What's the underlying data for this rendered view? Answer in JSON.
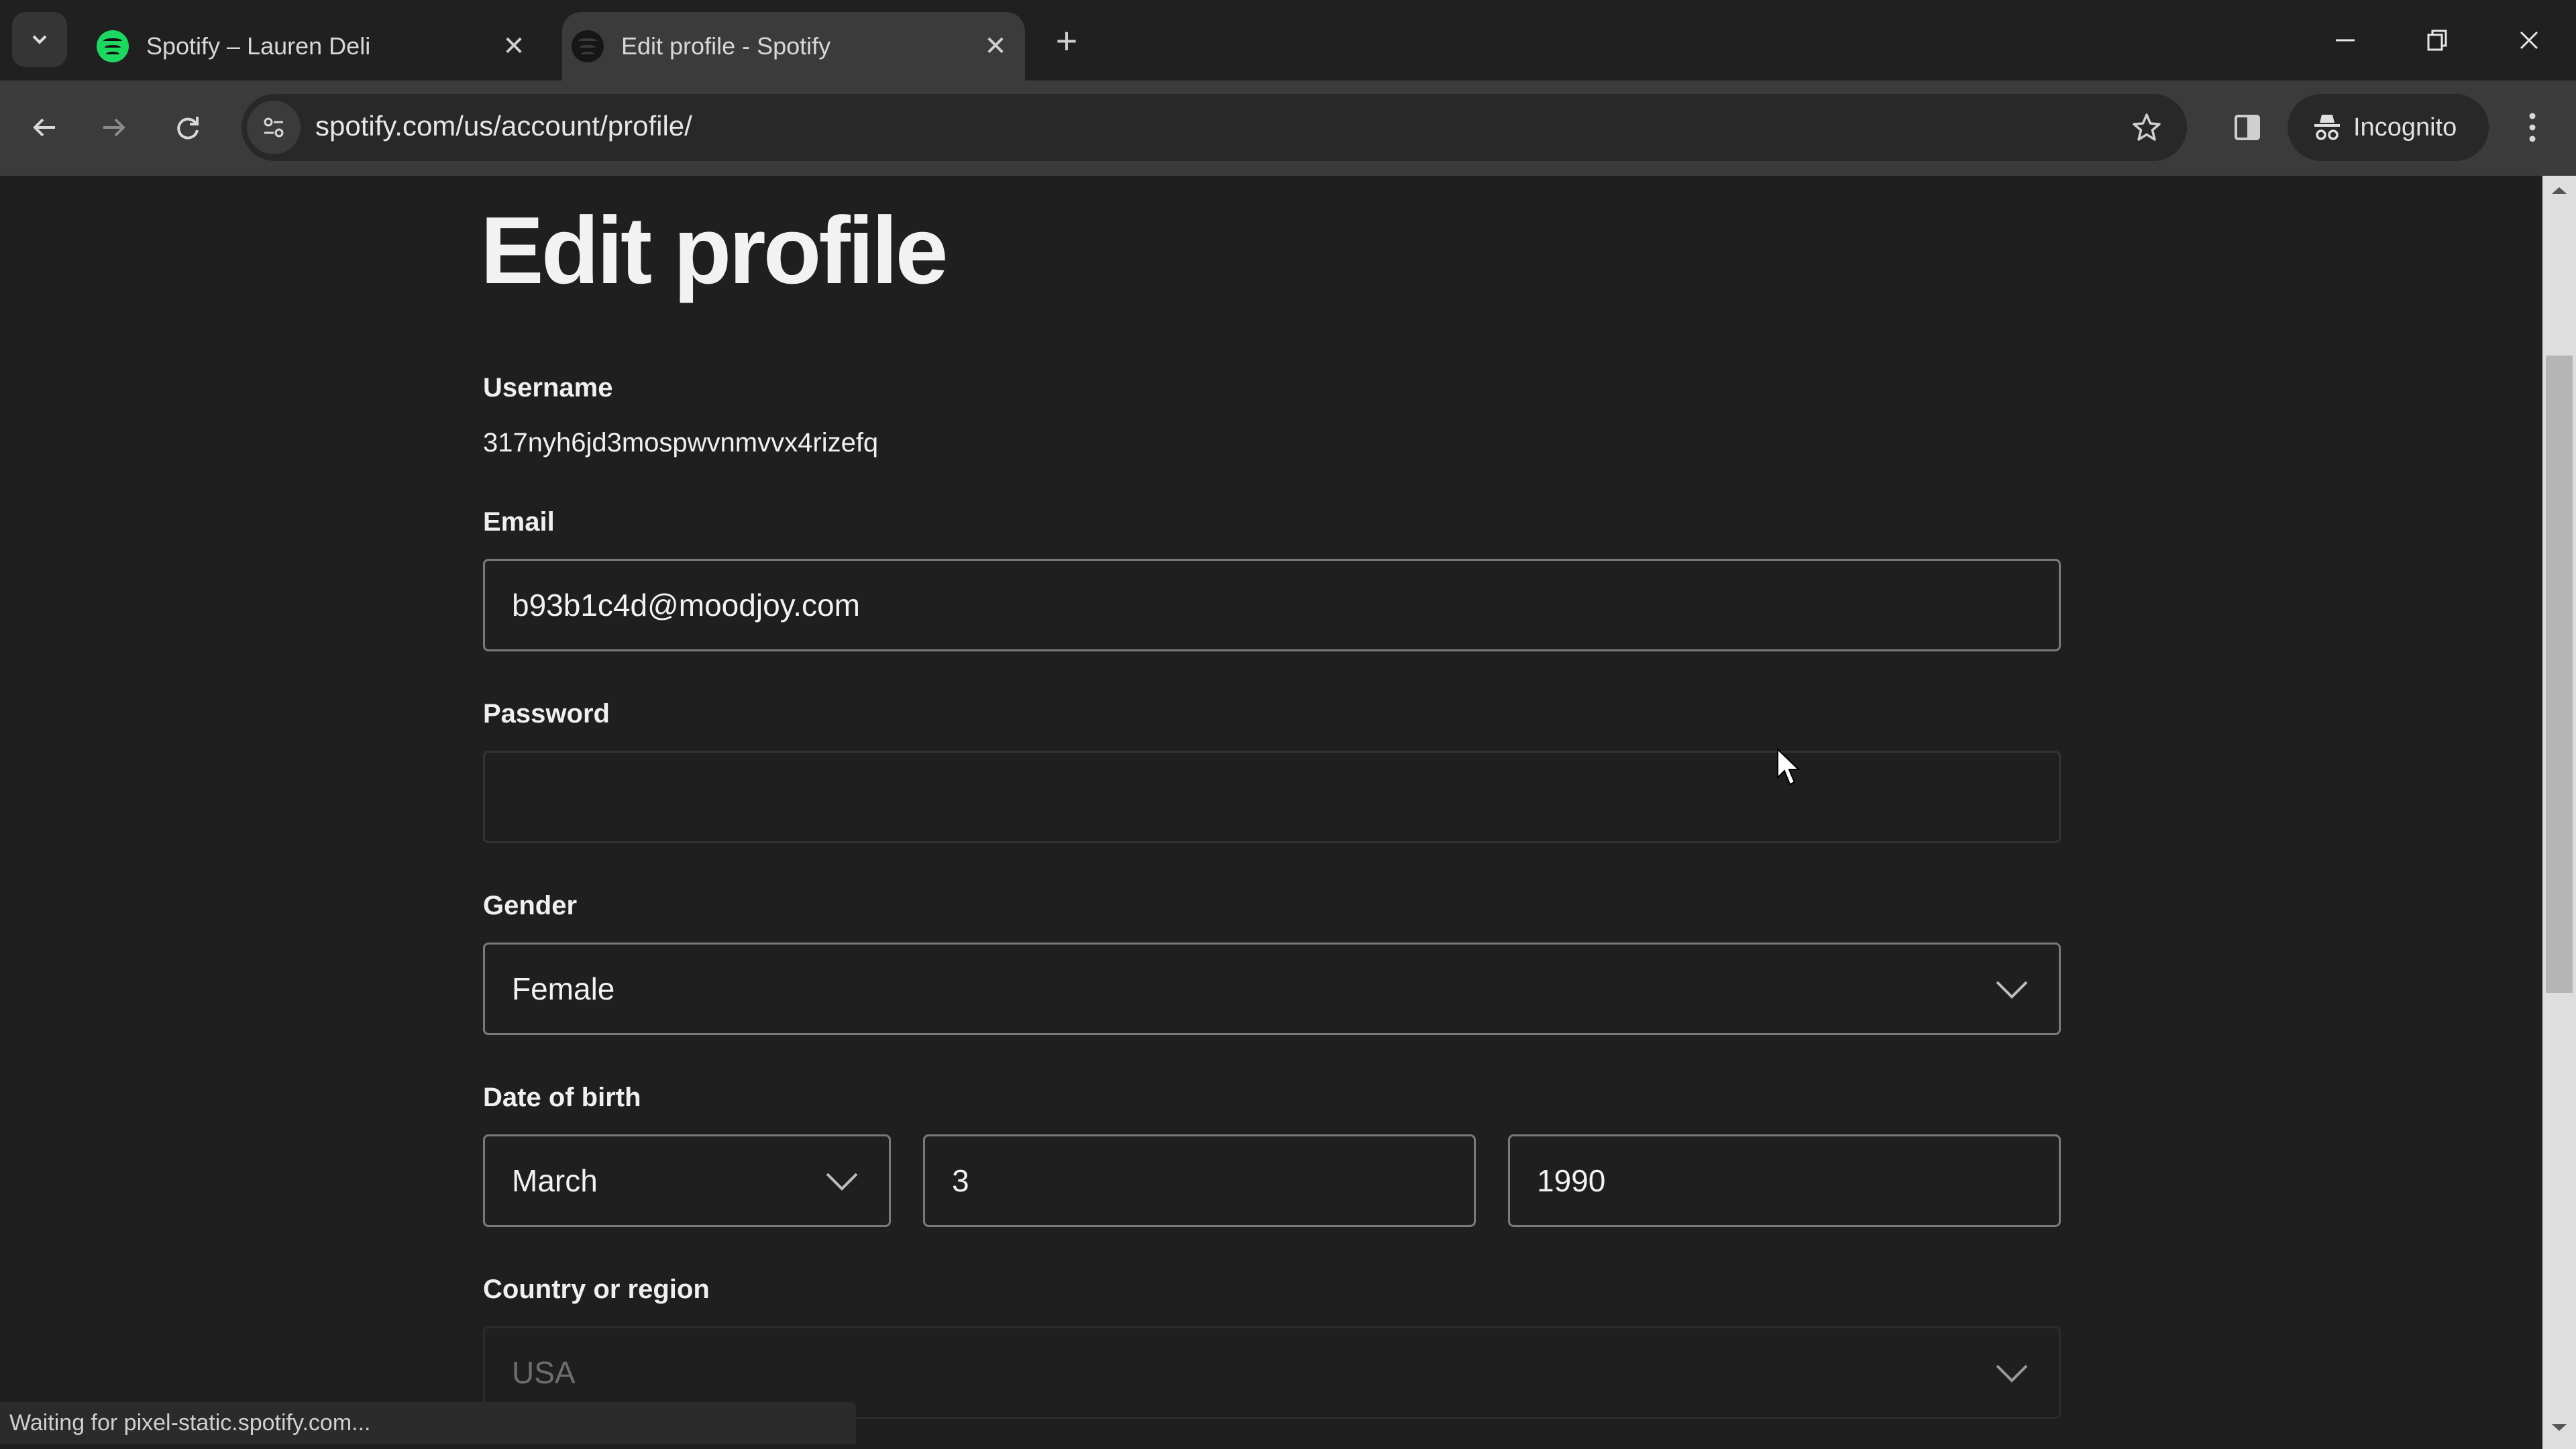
{
  "browser": {
    "tabs": [
      {
        "title": "Spotify – Lauren Deli",
        "active": false,
        "favicon": "spotify-logo-green"
      },
      {
        "title": "Edit profile - Spotify",
        "active": true,
        "favicon": "spotify-logo-dark"
      }
    ],
    "new_tab_symbol": "+",
    "close_symbol": "✕",
    "url": "spotify.com/us/account/profile/",
    "incognito_label": "Incognito",
    "status_text": "Waiting for pixel-static.spotify.com..."
  },
  "page": {
    "title": "Edit profile",
    "username": {
      "label": "Username",
      "value": "317nyh6jd3mospwvnmvvx4rizefq"
    },
    "email": {
      "label": "Email",
      "value": "b93b1c4d@moodjoy.com"
    },
    "password": {
      "label": "Password",
      "value": ""
    },
    "gender": {
      "label": "Gender",
      "value": "Female"
    },
    "date_of_birth": {
      "label": "Date of birth",
      "month": "March",
      "day": "3",
      "year": "1990"
    },
    "country": {
      "label": "Country or region",
      "value": "USA"
    }
  },
  "colors": {
    "background": "#1f1f1f",
    "spotify_green": "#1ed760",
    "chrome_toolbar": "#3b3b3b",
    "tabbar": "#202020"
  }
}
